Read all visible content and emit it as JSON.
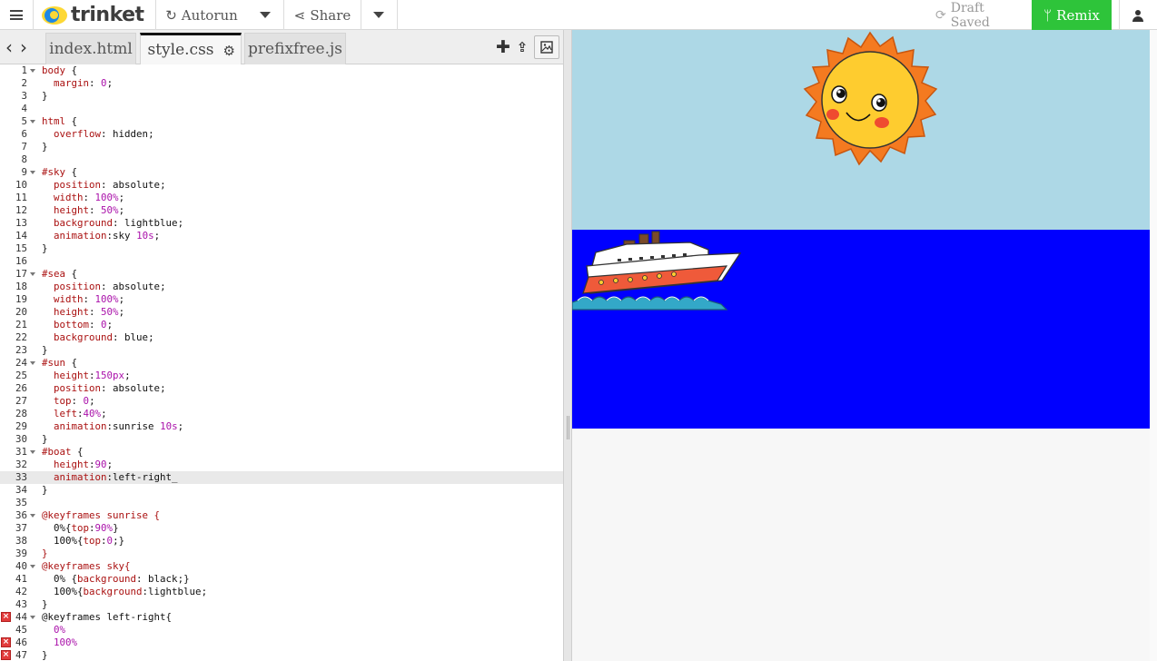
{
  "topbar": {
    "logo_text": "trinket",
    "autorun_label": "Autorun",
    "share_label": "Share",
    "draft_status": "Draft Saved",
    "remix_label": "Remix",
    "remix_color": "#2ec43a"
  },
  "editor_tabs": {
    "files": [
      "index.html",
      "style.css",
      "prefixfree.js"
    ],
    "active": "style.css"
  },
  "code_lines": [
    {
      "n": "1",
      "fold": true,
      "err": false,
      "parts": [
        [
          "c-sel",
          "body"
        ],
        [
          "c-plain",
          " {"
        ]
      ]
    },
    {
      "n": "2",
      "fold": false,
      "err": false,
      "parts": [
        [
          "c-plain",
          "  "
        ],
        [
          "c-prop",
          "margin"
        ],
        [
          "c-plain",
          ": "
        ],
        [
          "c-num",
          "0"
        ],
        [
          "c-plain",
          ";"
        ]
      ]
    },
    {
      "n": "3",
      "fold": false,
      "err": false,
      "parts": [
        [
          "c-plain",
          "}"
        ]
      ]
    },
    {
      "n": "4",
      "fold": false,
      "err": false,
      "parts": []
    },
    {
      "n": "5",
      "fold": true,
      "err": false,
      "parts": [
        [
          "c-sel",
          "html"
        ],
        [
          "c-plain",
          " {"
        ]
      ]
    },
    {
      "n": "6",
      "fold": false,
      "err": false,
      "parts": [
        [
          "c-plain",
          "  "
        ],
        [
          "c-prop",
          "overflow"
        ],
        [
          "c-plain",
          ": "
        ],
        [
          "c-val",
          "hidden"
        ],
        [
          "c-plain",
          ";"
        ]
      ]
    },
    {
      "n": "7",
      "fold": false,
      "err": false,
      "parts": [
        [
          "c-plain",
          "}"
        ]
      ]
    },
    {
      "n": "8",
      "fold": false,
      "err": false,
      "parts": []
    },
    {
      "n": "9",
      "fold": true,
      "err": false,
      "parts": [
        [
          "c-sel",
          "#sky"
        ],
        [
          "c-plain",
          " {"
        ]
      ]
    },
    {
      "n": "10",
      "fold": false,
      "err": false,
      "parts": [
        [
          "c-plain",
          "  "
        ],
        [
          "c-prop",
          "position"
        ],
        [
          "c-plain",
          ": "
        ],
        [
          "c-val",
          "absolute"
        ],
        [
          "c-plain",
          ";"
        ]
      ]
    },
    {
      "n": "11",
      "fold": false,
      "err": false,
      "parts": [
        [
          "c-plain",
          "  "
        ],
        [
          "c-prop",
          "width"
        ],
        [
          "c-plain",
          ": "
        ],
        [
          "c-pct",
          "100%"
        ],
        [
          "c-plain",
          ";"
        ]
      ]
    },
    {
      "n": "12",
      "fold": false,
      "err": false,
      "parts": [
        [
          "c-plain",
          "  "
        ],
        [
          "c-prop",
          "height"
        ],
        [
          "c-plain",
          ": "
        ],
        [
          "c-pct",
          "50%"
        ],
        [
          "c-plain",
          ";"
        ]
      ]
    },
    {
      "n": "13",
      "fold": false,
      "err": false,
      "parts": [
        [
          "c-plain",
          "  "
        ],
        [
          "c-prop",
          "background"
        ],
        [
          "c-plain",
          ": "
        ],
        [
          "c-val",
          "lightblue"
        ],
        [
          "c-plain",
          ";"
        ]
      ]
    },
    {
      "n": "14",
      "fold": false,
      "err": false,
      "parts": [
        [
          "c-plain",
          "  "
        ],
        [
          "c-prop",
          "animation"
        ],
        [
          "c-plain",
          ":"
        ],
        [
          "c-val",
          "sky "
        ],
        [
          "c-num",
          "10s"
        ],
        [
          "c-plain",
          ";"
        ]
      ]
    },
    {
      "n": "15",
      "fold": false,
      "err": false,
      "parts": [
        [
          "c-plain",
          "}"
        ]
      ]
    },
    {
      "n": "16",
      "fold": false,
      "err": false,
      "parts": []
    },
    {
      "n": "17",
      "fold": true,
      "err": false,
      "parts": [
        [
          "c-sel",
          "#sea"
        ],
        [
          "c-plain",
          " {"
        ]
      ]
    },
    {
      "n": "18",
      "fold": false,
      "err": false,
      "parts": [
        [
          "c-plain",
          "  "
        ],
        [
          "c-prop",
          "position"
        ],
        [
          "c-plain",
          ": "
        ],
        [
          "c-val",
          "absolute"
        ],
        [
          "c-plain",
          ";"
        ]
      ]
    },
    {
      "n": "19",
      "fold": false,
      "err": false,
      "parts": [
        [
          "c-plain",
          "  "
        ],
        [
          "c-prop",
          "width"
        ],
        [
          "c-plain",
          ": "
        ],
        [
          "c-pct",
          "100%"
        ],
        [
          "c-plain",
          ";"
        ]
      ]
    },
    {
      "n": "20",
      "fold": false,
      "err": false,
      "parts": [
        [
          "c-plain",
          "  "
        ],
        [
          "c-prop",
          "height"
        ],
        [
          "c-plain",
          ": "
        ],
        [
          "c-pct",
          "50%"
        ],
        [
          "c-plain",
          ";"
        ]
      ]
    },
    {
      "n": "21",
      "fold": false,
      "err": false,
      "parts": [
        [
          "c-plain",
          "  "
        ],
        [
          "c-prop",
          "bottom"
        ],
        [
          "c-plain",
          ": "
        ],
        [
          "c-num",
          "0"
        ],
        [
          "c-plain",
          ";"
        ]
      ]
    },
    {
      "n": "22",
      "fold": false,
      "err": false,
      "parts": [
        [
          "c-plain",
          "  "
        ],
        [
          "c-prop",
          "background"
        ],
        [
          "c-plain",
          ": "
        ],
        [
          "c-val",
          "blue"
        ],
        [
          "c-plain",
          ";"
        ]
      ]
    },
    {
      "n": "23",
      "fold": false,
      "err": false,
      "parts": [
        [
          "c-plain",
          "}"
        ]
      ]
    },
    {
      "n": "24",
      "fold": true,
      "err": false,
      "parts": [
        [
          "c-sel",
          "#sun"
        ],
        [
          "c-plain",
          " {"
        ]
      ]
    },
    {
      "n": "25",
      "fold": false,
      "err": false,
      "parts": [
        [
          "c-plain",
          "  "
        ],
        [
          "c-prop",
          "height"
        ],
        [
          "c-plain",
          ":"
        ],
        [
          "c-num",
          "150px"
        ],
        [
          "c-plain",
          ";"
        ]
      ]
    },
    {
      "n": "26",
      "fold": false,
      "err": false,
      "parts": [
        [
          "c-plain",
          "  "
        ],
        [
          "c-prop",
          "position"
        ],
        [
          "c-plain",
          ": "
        ],
        [
          "c-val",
          "absolute"
        ],
        [
          "c-plain",
          ";"
        ]
      ]
    },
    {
      "n": "27",
      "fold": false,
      "err": false,
      "parts": [
        [
          "c-plain",
          "  "
        ],
        [
          "c-prop",
          "top"
        ],
        [
          "c-plain",
          ": "
        ],
        [
          "c-num",
          "0"
        ],
        [
          "c-plain",
          ";"
        ]
      ]
    },
    {
      "n": "28",
      "fold": false,
      "err": false,
      "parts": [
        [
          "c-plain",
          "  "
        ],
        [
          "c-prop",
          "left"
        ],
        [
          "c-plain",
          ":"
        ],
        [
          "c-pct",
          "40%"
        ],
        [
          "c-plain",
          ";"
        ]
      ]
    },
    {
      "n": "29",
      "fold": false,
      "err": false,
      "parts": [
        [
          "c-plain",
          "  "
        ],
        [
          "c-prop",
          "animation"
        ],
        [
          "c-plain",
          ":"
        ],
        [
          "c-val",
          "sunrise "
        ],
        [
          "c-num",
          "10s"
        ],
        [
          "c-plain",
          ";"
        ]
      ]
    },
    {
      "n": "30",
      "fold": false,
      "err": false,
      "parts": [
        [
          "c-plain",
          "}"
        ]
      ]
    },
    {
      "n": "31",
      "fold": true,
      "err": false,
      "parts": [
        [
          "c-sel",
          "#boat"
        ],
        [
          "c-plain",
          " {"
        ]
      ]
    },
    {
      "n": "32",
      "fold": false,
      "err": false,
      "parts": [
        [
          "c-plain",
          "  "
        ],
        [
          "c-prop",
          "height"
        ],
        [
          "c-plain",
          ":"
        ],
        [
          "c-num",
          "90"
        ],
        [
          "c-plain",
          ";"
        ]
      ]
    },
    {
      "n": "33",
      "fold": false,
      "err": false,
      "active": true,
      "parts": [
        [
          "c-plain",
          "  "
        ],
        [
          "c-prop",
          "animation"
        ],
        [
          "c-plain",
          ":"
        ],
        [
          "c-val",
          "left-right_"
        ]
      ]
    },
    {
      "n": "34",
      "fold": false,
      "err": false,
      "parts": [
        [
          "c-plain",
          "}"
        ]
      ]
    },
    {
      "n": "35",
      "fold": false,
      "err": false,
      "parts": []
    },
    {
      "n": "36",
      "fold": true,
      "err": false,
      "parts": [
        [
          "c-kw",
          "@keyframes sunrise {"
        ]
      ]
    },
    {
      "n": "37",
      "fold": false,
      "err": false,
      "parts": [
        [
          "c-plain",
          "  0%{"
        ],
        [
          "c-prop",
          "top"
        ],
        [
          "c-plain",
          ":"
        ],
        [
          "c-pct",
          "90%"
        ],
        [
          "c-plain",
          "}"
        ]
      ]
    },
    {
      "n": "38",
      "fold": false,
      "err": false,
      "parts": [
        [
          "c-plain",
          "  100%{"
        ],
        [
          "c-prop",
          "top"
        ],
        [
          "c-plain",
          ":"
        ],
        [
          "c-num",
          "0"
        ],
        [
          "c-plain",
          ";}"
        ]
      ]
    },
    {
      "n": "39",
      "fold": false,
      "err": false,
      "parts": [
        [
          "c-kw",
          "}"
        ]
      ]
    },
    {
      "n": "40",
      "fold": true,
      "err": false,
      "parts": [
        [
          "c-kw",
          "@keyframes sky{"
        ]
      ]
    },
    {
      "n": "41",
      "fold": false,
      "err": false,
      "parts": [
        [
          "c-plain",
          "  0% {"
        ],
        [
          "c-prop",
          "background"
        ],
        [
          "c-plain",
          ": "
        ],
        [
          "c-val",
          "black"
        ],
        [
          "c-plain",
          ";}"
        ]
      ]
    },
    {
      "n": "42",
      "fold": false,
      "err": false,
      "parts": [
        [
          "c-plain",
          "  100%{"
        ],
        [
          "c-prop",
          "background"
        ],
        [
          "c-plain",
          ":"
        ],
        [
          "c-val",
          "lightblue"
        ],
        [
          "c-plain",
          ";"
        ]
      ]
    },
    {
      "n": "43",
      "fold": false,
      "err": false,
      "parts": [
        [
          "c-plain",
          "}"
        ]
      ]
    },
    {
      "n": "44",
      "fold": true,
      "err": true,
      "parts": [
        [
          "c-plain",
          "@keyframes left-right{"
        ]
      ]
    },
    {
      "n": "45",
      "fold": false,
      "err": false,
      "parts": [
        [
          "c-pct",
          "  0%"
        ]
      ]
    },
    {
      "n": "46",
      "fold": false,
      "err": true,
      "parts": [
        [
          "c-pct",
          "  100%"
        ]
      ]
    },
    {
      "n": "47",
      "fold": false,
      "err": true,
      "parts": [
        [
          "c-plain",
          "}"
        ]
      ]
    }
  ],
  "preview": {
    "sky_color": "#add8e6",
    "sea_color": "#0000ff",
    "sun_image": "smiling-sun",
    "boat_image": "cruise-ship"
  },
  "icons": {
    "menu": "hamburger-icon",
    "autorun": "refresh-icon",
    "share": "share-icon",
    "draft": "sync-icon",
    "remix": "fork-icon",
    "user": "user-icon"
  }
}
